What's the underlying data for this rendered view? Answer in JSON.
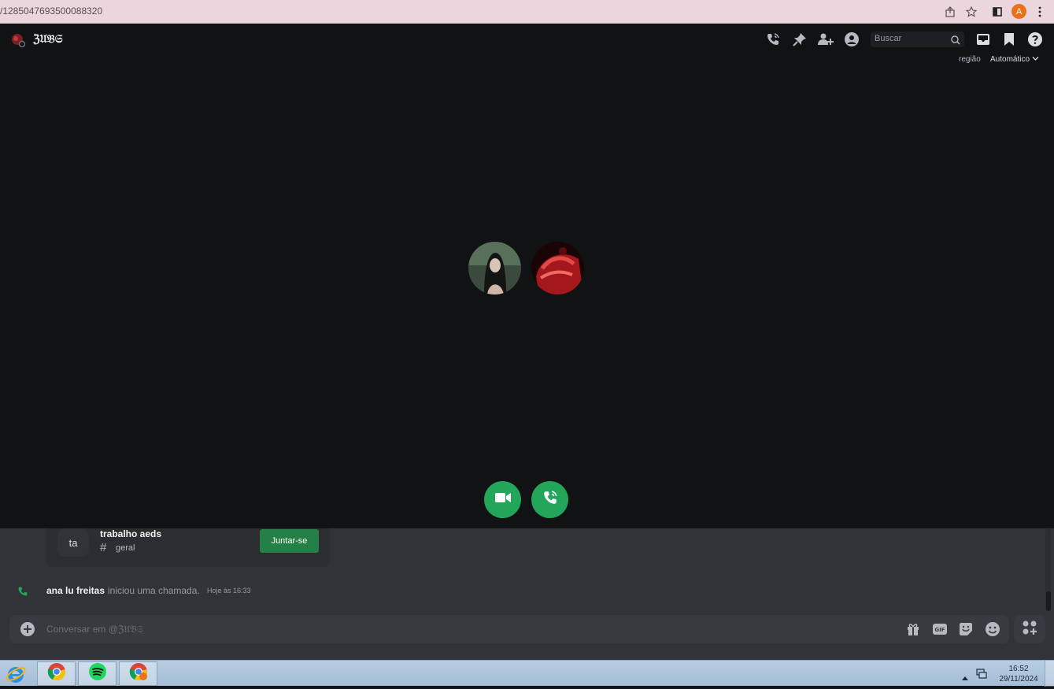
{
  "browser": {
    "url": "/1285047693500088320",
    "profile_initial": "A"
  },
  "header": {
    "server_name": "ℨ𝔘𝔅𝔖",
    "search_placeholder": "Buscar",
    "region_label": "região",
    "region_value": "Automático"
  },
  "call": {
    "participants": [
      "avatar-1",
      "avatar-2"
    ]
  },
  "chat": {
    "invite": {
      "icon_text": "ta",
      "server_name": "trabalho aeds",
      "channel": "geral",
      "join_label": "Juntar-se"
    },
    "system_message": {
      "user": "ana lu freitas",
      "text": "iniciou uma chamada.",
      "time": "Hoje às 16:33"
    },
    "composer_placeholder": "Conversar em @ℨ𝔘𝔅𝔖"
  },
  "taskbar": {
    "time": "16:52",
    "date": "29/11/2024"
  },
  "colors": {
    "accent_green": "#23a55a",
    "join_green": "#248046",
    "background": "#111214",
    "chat_bg": "#313338"
  }
}
